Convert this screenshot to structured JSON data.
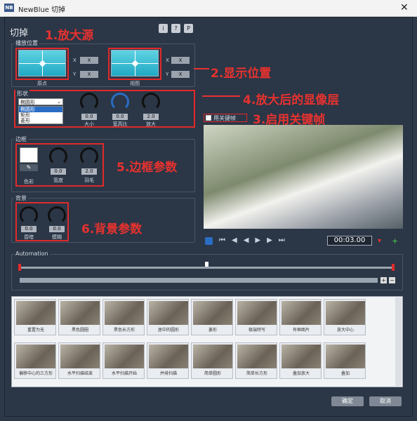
{
  "window": {
    "title": "NewBlue 切掉",
    "logo": "NB",
    "close_glyph": "✕"
  },
  "header": {
    "title": "切掉",
    "buttons": [
      "i",
      "?",
      "P"
    ]
  },
  "position_group": {
    "label": "播放位置",
    "origin_label": "原点",
    "view_label": "视图",
    "x": "X",
    "y": "Y",
    "x_val": "X",
    "y_val": "X"
  },
  "shape_group": {
    "label": "形状",
    "dropdown_value": "椭圆形",
    "options": [
      "椭圆形",
      "矩形",
      "菱形"
    ],
    "knobs": [
      {
        "label": "大小",
        "value": "0.0"
      },
      {
        "label": "宽高比",
        "value": "0.0"
      },
      {
        "label": "放大",
        "value": "2.0"
      }
    ]
  },
  "keyframe": {
    "label": "用关键帧"
  },
  "border_group": {
    "label": "边框",
    "color_label": "色彩",
    "knobs": [
      {
        "label": "宽度",
        "value": "0.0"
      },
      {
        "label": "羽毛",
        "value": "2.0"
      }
    ]
  },
  "bg_group": {
    "label": "背景",
    "knobs": [
      {
        "label": "昏暗",
        "value": "0.0"
      },
      {
        "label": "模糊",
        "value": "0.0"
      }
    ]
  },
  "annotations": {
    "a1": "1.放大源",
    "a2": "2.显示位置",
    "a3": "3.启用关键帧",
    "a4": "4.放大后的显像层",
    "a5": "5.边框参数",
    "a6": "6.背景参数"
  },
  "transport": {
    "timecode": "00:03.00"
  },
  "automation": {
    "label": "Automation"
  },
  "presets": [
    "重置为无",
    "黑色圆圈",
    "黑色长方形",
    "居中的圆形",
    "菱形",
    "极端特写",
    "有框图片",
    "放大中心",
    "偏移中心的三方形",
    "水平扫描结束",
    "水平扫描开始",
    "并排扫描",
    "简单圆形",
    "简单长方形",
    "叠加放大",
    "叠加"
  ],
  "footer": {
    "ok": "确定",
    "cancel": "取消"
  },
  "colors": {
    "annotation": "#e8322f",
    "panel": "#2b3646",
    "accent": "#2a6dc4"
  }
}
